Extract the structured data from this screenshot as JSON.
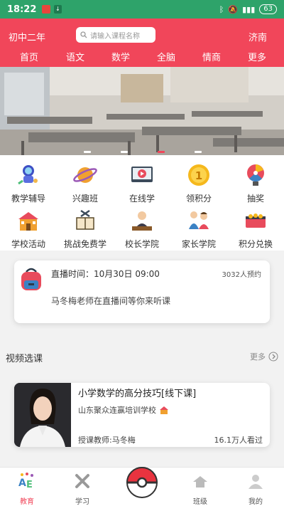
{
  "status_bar": {
    "time": "18:22",
    "battery": "63"
  },
  "header": {
    "grade": "初中二年",
    "search_placeholder": "请输入课程名称",
    "city": "济南",
    "tabs": [
      "首页",
      "语文",
      "数学",
      "全脑",
      "情商",
      "更多"
    ]
  },
  "grid": [
    {
      "label": "教学辅导",
      "icon": "astronaut-icon"
    },
    {
      "label": "兴趣班",
      "icon": "planet-icon"
    },
    {
      "label": "在线学",
      "icon": "video-player-icon"
    },
    {
      "label": "领积分",
      "icon": "gold-coin-icon"
    },
    {
      "label": "抽奖",
      "icon": "prize-wheel-icon"
    },
    {
      "label": "学校活动",
      "icon": "school-building-icon"
    },
    {
      "label": "挑战免费学",
      "icon": "book-flag-icon"
    },
    {
      "label": "校长学院",
      "icon": "principal-icon"
    },
    {
      "label": "家长学院",
      "icon": "parents-icon"
    },
    {
      "label": "积分兑换",
      "icon": "treasure-icon"
    }
  ],
  "live": {
    "title": "直播时间：10月30日 09:00",
    "count": "3032人预约",
    "message": "马冬梅老师在直播间等你来听课"
  },
  "section": {
    "title": "视频选课",
    "more": "更多"
  },
  "course": {
    "title": "小学数学的高分技巧[线下课]",
    "school": "山东聚众连赢培训学校",
    "teacher": "授课教师:马冬梅",
    "views": "16.1万人看过"
  },
  "bottom_nav": [
    {
      "label": "教育",
      "icon": "ae-logo-icon"
    },
    {
      "label": "学习",
      "icon": "cross-icon"
    },
    {
      "label": "班级",
      "icon": "class-icon"
    },
    {
      "label": "我的",
      "icon": "profile-icon"
    }
  ],
  "colors": {
    "status": "#2ea36a",
    "brand": "#f1465a"
  }
}
